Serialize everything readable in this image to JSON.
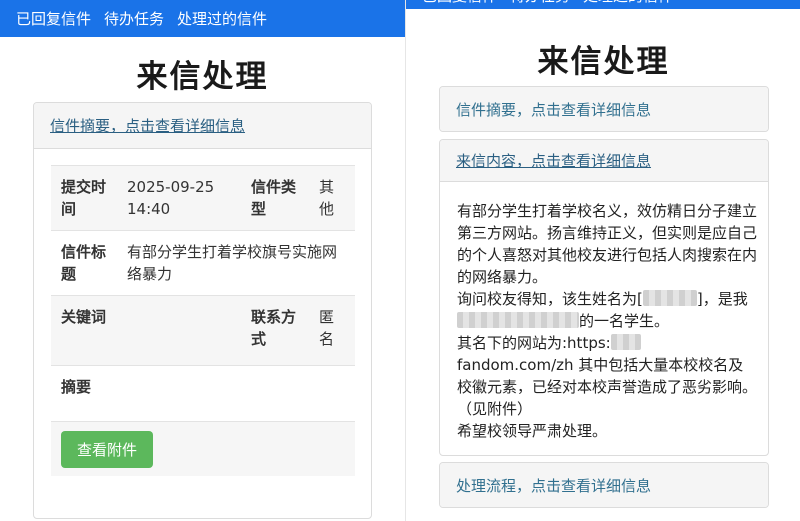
{
  "nav": {
    "items": [
      "已回复信件",
      "待办任务",
      "处理过的信件"
    ]
  },
  "page": {
    "title": "来信处理"
  },
  "left": {
    "summary_header": "信件摘要，点击查看详细信息",
    "rows": [
      {
        "k1": "提交时间",
        "v1": "2025-09-25 14:40",
        "k2": "信件类型",
        "v2": "其他"
      },
      {
        "k1": "信件标题",
        "v1": "有部分学生打着学校旗号实施网络暴力"
      },
      {
        "k1": "关键词",
        "v1": "",
        "k2": "联系方式",
        "v2": "匿名"
      },
      {
        "k1": "摘要",
        "v1": ""
      }
    ],
    "attach_button": "查看附件"
  },
  "right": {
    "summary_header": "信件摘要，点击查看详细信息",
    "content_header": "来信内容，点击查看详细信息",
    "process_header": "处理流程，点击查看详细信息",
    "content": {
      "p1": "有部分学生打着学校名义，效仿精日分子建立第三方网站。扬言维持正义，但实则是应自己的个人喜怒对其他校友进行包括人肉搜索在内的网络暴力。",
      "p2a": "询问校友得知，该生姓名为[",
      "p2b": "]，是我",
      "p2c": "的一名学生。",
      "p3a": "其名下的网站为:https:",
      "p3b": "fandom.com/zh 其中包括大量本校校名及校徽元素，已经对本校声誉造成了恶劣影响。（见附件）",
      "p4": "希望校领导严肃处理。"
    }
  },
  "colors": {
    "navbar": "#1a73e8",
    "link": "#31708f",
    "button": "#5cb85c"
  }
}
